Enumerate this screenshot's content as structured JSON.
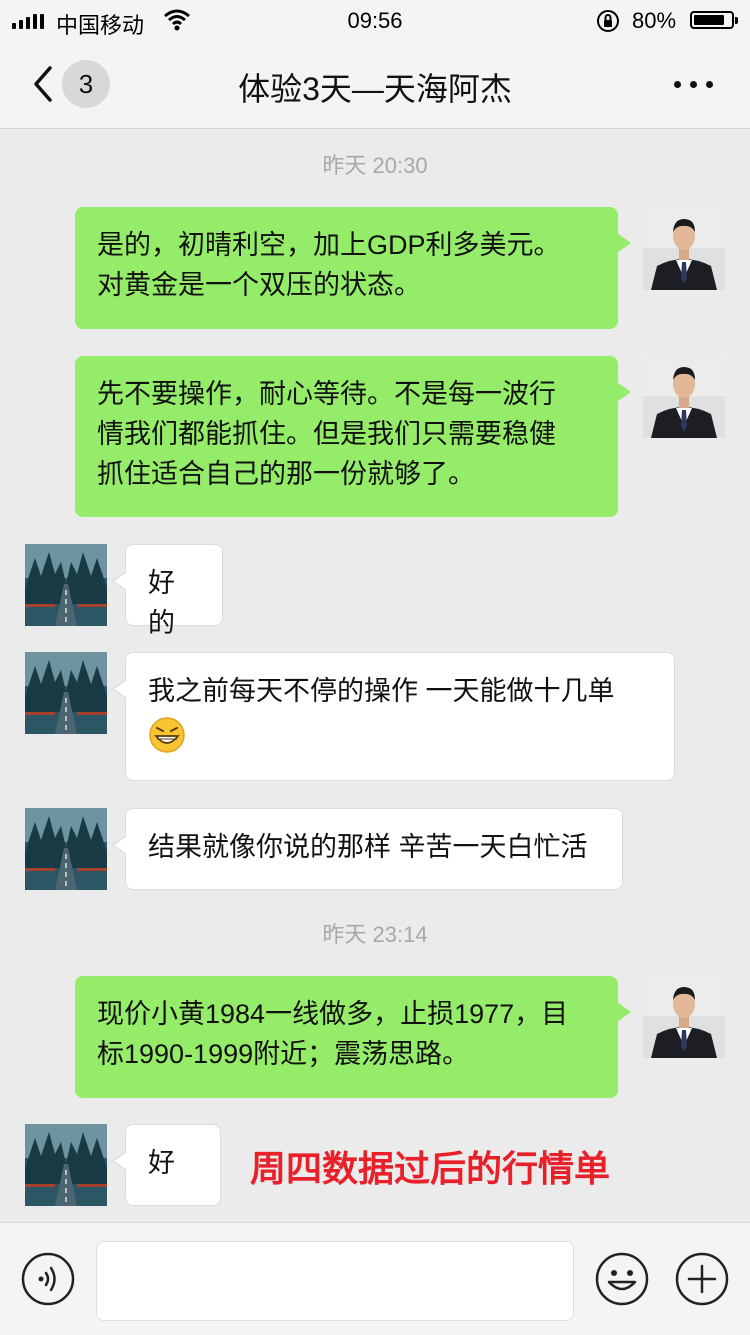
{
  "status_bar": {
    "carrier": "中国移动",
    "time": "09:56",
    "battery_percent": "80%",
    "battery_level": 0.8,
    "icons": [
      "signal-icon",
      "wifi-icon",
      "orientation-lock-icon",
      "battery-icon"
    ]
  },
  "nav": {
    "back_icon": "chevron-left-icon",
    "unread_count": "3",
    "title": "体验3天—天海阿杰",
    "more_icon": "more-dots-icon"
  },
  "chat": {
    "timestamps": [
      "昨天 20:30",
      "昨天 23:14"
    ],
    "messages": [
      {
        "side": "out",
        "lines": [
          "是的，初晴利空，加上GDP利多美元。",
          "对黄金是一个双压的状态。"
        ]
      },
      {
        "side": "out",
        "lines": [
          "先不要操作，耐心等待。不是每一波行",
          "情我们都能抓住。但是我们只需要稳健",
          "抓住适合自己的那一份就够了。"
        ]
      },
      {
        "side": "in",
        "lines": [
          "好的"
        ]
      },
      {
        "side": "in",
        "lines": [
          "我之前每天不停的操作 一天能做十几单"
        ],
        "emoji": "grin-emoji-icon"
      },
      {
        "side": "in",
        "lines": [
          "结果就像你说的那样 辛苦一天白忙活"
        ]
      },
      {
        "side": "out",
        "lines": [
          "现价小黄1984一线做多，止损1977，目",
          "标1990-1999附近；震荡思路。"
        ]
      },
      {
        "side": "in",
        "lines": [
          "好"
        ]
      }
    ],
    "annotation": "周四数据过后的行情单"
  },
  "colors": {
    "outgoing_bubble": "#95ec69",
    "incoming_bubble": "#ffffff",
    "background": "#ebebeb",
    "annotation": "#e8202a"
  },
  "input_bar": {
    "voice_icon": "voice-icon",
    "emoji_icon": "emoji-icon",
    "plus_icon": "plus-icon",
    "input_value": ""
  }
}
